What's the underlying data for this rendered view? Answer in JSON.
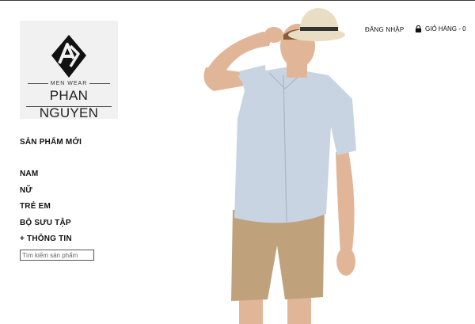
{
  "brand": {
    "tagline": "MEN WEAR",
    "name": "PHAN NGUYEN"
  },
  "header": {
    "login_label": "ĐĂNG NHẬP",
    "cart_label": "GIỎ HÀNG - 0"
  },
  "nav": {
    "new_products": "SẢN PHẨM MỚI",
    "items": [
      "NAM",
      "NỮ",
      "TRẺ EM",
      "BỘ SƯU TẬP",
      "+ THÔNG TIN"
    ]
  },
  "search": {
    "placeholder": "Tìm kiếm sản phẩm",
    "value": ""
  },
  "colors": {
    "shirt": "#c9d4e2",
    "shorts": "#bfa27c",
    "hat": "#e9ddc3",
    "skin": "#e1b698"
  },
  "icons": {
    "cart": "shopping-bag-icon",
    "logo": "logo-mark-icon"
  }
}
